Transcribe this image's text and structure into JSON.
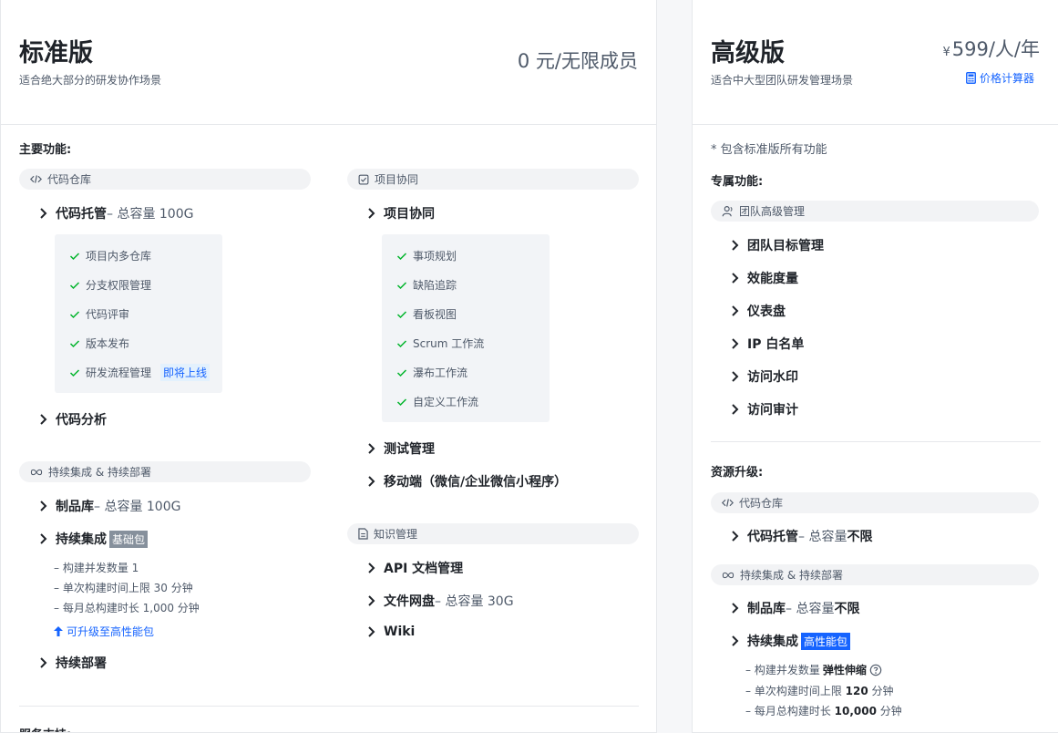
{
  "standard": {
    "title": "标准版",
    "subtitle": "适合绝大部分的研发协作场景",
    "price": "0 元/无限成员",
    "main_features_label": "主要功能:",
    "code_repo": {
      "pill": "代码仓库",
      "hosting": "代码托管",
      "hosting_note": "– 总容量 100G",
      "hosting_sub": [
        "项目内多仓库",
        "分支权限管理",
        "代码评审",
        "版本发布",
        "研发流程管理"
      ],
      "hosting_badge": "即将上线",
      "analysis": "代码分析"
    },
    "ci_cd": {
      "pill": "持续集成 & 持续部署",
      "artifacts": "制品库",
      "artifacts_note": "– 总容量 100G",
      "ci": "持续集成",
      "ci_badge": "基础包",
      "ci_lines": [
        "– 构建并发数量 1",
        "– 单次构建时间上限 30 分钟",
        "– 每月总构建时长 1,000 分钟"
      ],
      "upgrade_link": "可升级至高性能包",
      "cd": "持续部署"
    },
    "project": {
      "pill": "项目协同",
      "collab": "项目协同",
      "collab_sub": [
        "事项规划",
        "缺陷追踪",
        "看板视图",
        "Scrum 工作流",
        "瀑布工作流",
        "自定义工作流"
      ],
      "testing": "测试管理",
      "mobile": "移动端（微信/企业微信小程序）"
    },
    "knowledge": {
      "pill": "知识管理",
      "api": "API 文档管理",
      "disk": "文件网盘",
      "disk_note": "– 总容量 30G",
      "wiki": "Wiki"
    },
    "service_label": "服务支持:"
  },
  "advanced": {
    "title": "高级版",
    "subtitle": "适合中大型团队研发管理场景",
    "price_symbol": "¥",
    "price": "599/人/年",
    "calculator": "价格计算器",
    "includes": "* 包含标准版所有功能",
    "exclusive_label": "专属功能:",
    "team_pill": "团队高级管理",
    "team_items": [
      "团队目标管理",
      "效能度量",
      "仪表盘",
      "IP 白名单",
      "访问水印",
      "访问审计"
    ],
    "resource_label": "资源升级:",
    "code_pill": "代码仓库",
    "hosting": "代码托管",
    "hosting_note_prefix": "– 总容量",
    "hosting_note_value": "不限",
    "ci_pill": "持续集成 & 持续部署",
    "artifacts": "制品库",
    "artifacts_note_prefix": "– 总容量",
    "artifacts_note_value": "不限",
    "ci": "持续集成",
    "ci_badge": "高性能包",
    "ci_line1_prefix": "– 构建并发数量",
    "ci_line1_value": "弹性伸缩",
    "ci_line2_prefix": "– 单次构建时间上限",
    "ci_line2_value": "120",
    "ci_line2_suffix": "分钟",
    "ci_line3_prefix": "– 每月总构建时长",
    "ci_line3_value": "10,000",
    "ci_line3_suffix": "分钟"
  }
}
